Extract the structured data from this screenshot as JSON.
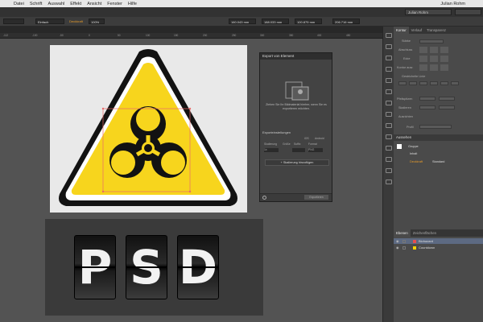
{
  "menubar": {
    "apple": "",
    "app": "",
    "items": [
      "Datei",
      "Schrift",
      "Auswahl",
      "Effekt",
      "Ansicht",
      "Fenster",
      "Hilfe"
    ],
    "right": "Julian Rohm"
  },
  "appbar": {
    "user": "Julian Rohm"
  },
  "control": {
    "stroke": "Einfach",
    "opacity": "Deckkraft",
    "fields": [
      "100%",
      "160,043 mm",
      "188,033 mm",
      "100,875 mm",
      "206,716 mm"
    ]
  },
  "ruler": {
    "labels": [
      "-112",
      "-100",
      "-50",
      "0",
      "50",
      "100",
      "150",
      "200",
      "250",
      "300",
      "350",
      "400",
      "450"
    ]
  },
  "artboard": {
    "tiles": [
      "P",
      "S",
      "D"
    ]
  },
  "export_panel": {
    "title": "Export von Element",
    "hint": "Ziehen Sie Ihr Bildmaterial hierher, wenn Sie es exportieren möchten.",
    "settings": "Exporteinstellungen",
    "ios": "iOS",
    "android": "Android",
    "col_headers": [
      "Skalierung",
      "Größe",
      "Suffix",
      "Format"
    ],
    "row_values": [
      "1x",
      "",
      "PNG"
    ],
    "add_scaling": "+ Skalierung hinzufügen",
    "export_button": "Exportieren"
  },
  "right_panel": {
    "tabs": [
      "Kontur",
      "Verlauf",
      "Transparenz"
    ],
    "stroke_label": "Stärke",
    "cap_label": "Abschluss",
    "corner_label": "Ecke",
    "align_label": "Kontur ausr.",
    "dash_label": "Gestrichelte Linie",
    "arrow_label": "Pfeilspitzen",
    "scale_label": "Skalieren",
    "align2_label": "Ausrichten",
    "profile_label": "Profil",
    "appearance_title": "Aussehen",
    "group_label": "Gruppe",
    "content_label": "Inhalt",
    "opacity_label": "Deckkraft",
    "standard_label": "Standard",
    "layers_tabs": [
      "Ebenen",
      "Zeichenflächen"
    ],
    "layers": [
      {
        "name": "Biohazard",
        "color": "#e64e4e"
      },
      {
        "name": "Countdown",
        "color": "#f2d200"
      }
    ]
  },
  "colors": {
    "warning_yellow": "#f7d51d",
    "sign_black": "#121212",
    "selection": "#e86a6a"
  }
}
